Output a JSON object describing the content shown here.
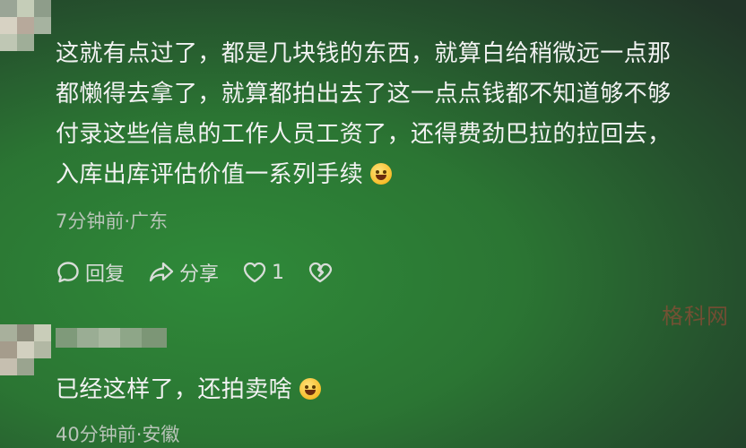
{
  "comments": [
    {
      "lines": [
        "这就有点过了，都是几块钱的东西，就算白给稍微远一点那",
        "都懒得去拿了，就算都拍出去了这一点点钱都不知道够不够",
        "付录这些信息的工作人员工资了，还得费劲巴拉的拉回去，",
        "入库出库评估价值一系列手续"
      ],
      "emoji": "rofl-emoji",
      "meta": "7分钟前·广东",
      "actions": {
        "reply_label": "回复",
        "share_label": "分享",
        "like_count": "1"
      }
    },
    {
      "lines": [
        "已经这样了，还拍卖啥"
      ],
      "emoji": "grinning-sweat-emoji",
      "meta": "40分钟前·安徽"
    }
  ],
  "watermark": "格科网",
  "colors": {
    "background": "#2b7533",
    "text": "#f2f2f2",
    "meta": "#b8c4b8",
    "watermark": "#dc463c"
  }
}
